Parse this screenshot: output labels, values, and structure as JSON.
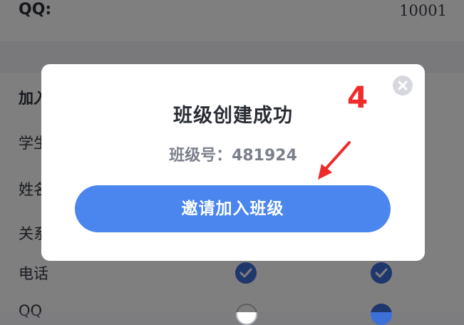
{
  "header_row": {
    "label": "QQ:",
    "value": "10001"
  },
  "background_form": {
    "section_title_left": "加入",
    "section_title_right": "",
    "fields": [
      {
        "label": "学生"
      },
      {
        "label": "姓名"
      },
      {
        "label": "关系"
      },
      {
        "label": "电话"
      },
      {
        "label": "QQ"
      }
    ]
  },
  "modal": {
    "title": "班级创建成功",
    "class_number_label": "班级号：",
    "class_number_value": "481924",
    "class_number_text": "班级号：481924",
    "invite_button": "邀请加入班级",
    "close_icon": "close-icon"
  },
  "annotation": {
    "step_number": "4",
    "arrow_icon": "red-arrow-icon"
  },
  "colors": {
    "primary_button": "#4a86ee",
    "check_fill": "#3d6fd9",
    "annotation_red": "#ef2b2b"
  }
}
